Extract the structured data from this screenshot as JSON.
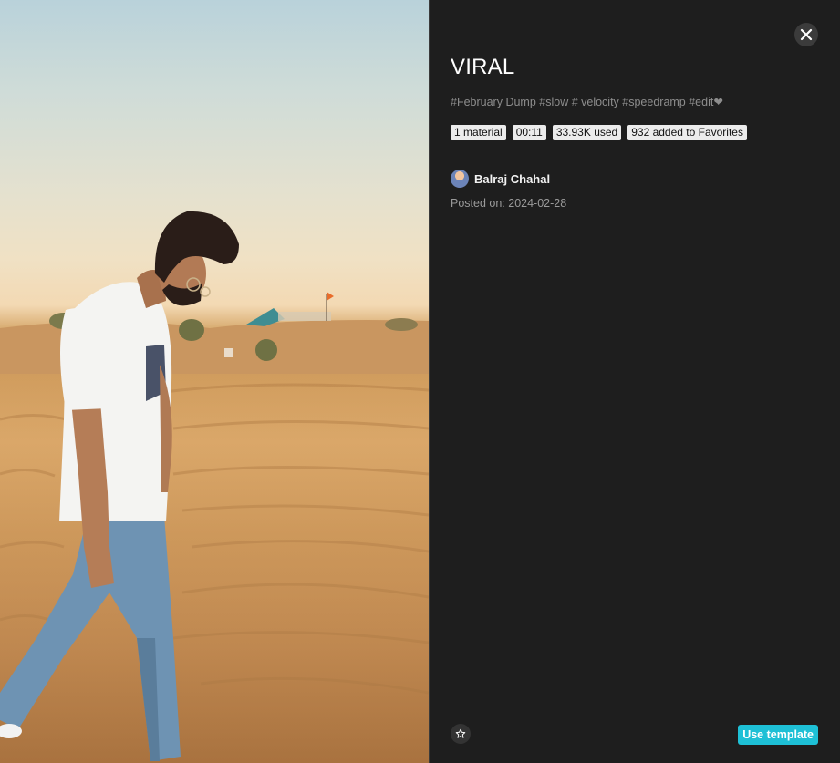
{
  "template": {
    "title": "VIRAL",
    "tags": "#February Dump #slow # velocity  #speedramp #edit❤",
    "badges": [
      "1 material",
      "00:11",
      "33.93K used",
      "932 added to Favorites"
    ],
    "author": {
      "name": "Balraj Chahal"
    },
    "posted_on": "Posted on: 2024-02-28"
  },
  "actions": {
    "use_template_label": "Use template",
    "close_icon": "close-icon",
    "favorite_icon": "star-outline-icon"
  },
  "colors": {
    "panel_background": "#1e1e1e",
    "accent": "#1ec0d6",
    "badge_background": "#ececec"
  }
}
